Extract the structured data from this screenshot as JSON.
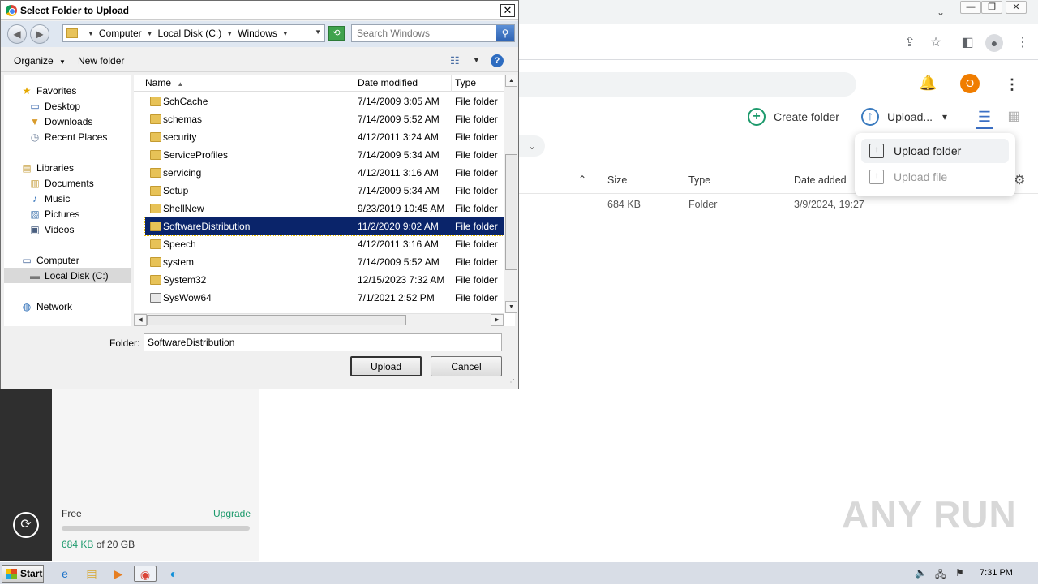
{
  "browser": {
    "window_controls": [
      "—",
      "❐",
      "✕"
    ],
    "tab_dropdown_icon": "chevron-down-icon",
    "toolbar_icons": [
      "share-icon",
      "star-icon",
      "sidepanel-icon",
      "profile-icon",
      "menu-icon"
    ]
  },
  "app": {
    "user_initial": "O",
    "create_folder_label": "Create folder",
    "upload_label": "Upload...",
    "upload_menu": {
      "items": [
        {
          "label": "Upload folder",
          "state": "hover"
        },
        {
          "label": "Upload file",
          "state": "disabled"
        }
      ]
    },
    "table": {
      "columns": [
        "Size",
        "Type",
        "Date added"
      ],
      "row": {
        "size": "684 KB",
        "type": "Folder",
        "date_added": "3/9/2024, 19:27"
      }
    },
    "sidebar": {
      "plan": "Free",
      "upgrade": "Upgrade",
      "quota_used": "684 KB",
      "quota_of": " of 20 GB",
      "quota_fraction": 0.0
    },
    "accent_color": "#1d9a6c"
  },
  "dialog": {
    "title": "Select Folder to Upload",
    "breadcrumb": [
      "Computer",
      "Local Disk (C:)",
      "Windows"
    ],
    "search_placeholder": "Search Windows",
    "toolbar": {
      "organize": "Organize",
      "new_folder": "New folder"
    },
    "nav": [
      {
        "label": "Favorites",
        "icon": "star-icon",
        "indent": 0
      },
      {
        "label": "Desktop",
        "icon": "desktop-icon",
        "indent": 1
      },
      {
        "label": "Downloads",
        "icon": "downloads-icon",
        "indent": 1
      },
      {
        "label": "Recent Places",
        "icon": "recent-places-icon",
        "indent": 1
      },
      {
        "label": "Libraries",
        "icon": "libraries-icon",
        "indent": 0
      },
      {
        "label": "Documents",
        "icon": "documents-icon",
        "indent": 1
      },
      {
        "label": "Music",
        "icon": "music-icon",
        "indent": 1
      },
      {
        "label": "Pictures",
        "icon": "pictures-icon",
        "indent": 1
      },
      {
        "label": "Videos",
        "icon": "videos-icon",
        "indent": 1
      },
      {
        "label": "Computer",
        "icon": "computer-icon",
        "indent": 0
      },
      {
        "label": "Local Disk (C:)",
        "icon": "disk-icon",
        "indent": 1,
        "selected": true
      },
      {
        "label": "Network",
        "icon": "network-icon",
        "indent": 0
      }
    ],
    "columns": {
      "name": "Name",
      "date": "Date modified",
      "type": "Type"
    },
    "files": [
      {
        "name": "SchCache",
        "date": "7/14/2009 3:05 AM",
        "type": "File folder"
      },
      {
        "name": "schemas",
        "date": "7/14/2009 5:52 AM",
        "type": "File folder"
      },
      {
        "name": "security",
        "date": "4/12/2011 3:24 AM",
        "type": "File folder"
      },
      {
        "name": "ServiceProfiles",
        "date": "7/14/2009 5:34 AM",
        "type": "File folder"
      },
      {
        "name": "servicing",
        "date": "4/12/2011 3:16 AM",
        "type": "File folder"
      },
      {
        "name": "Setup",
        "date": "7/14/2009 5:34 AM",
        "type": "File folder"
      },
      {
        "name": "ShellNew",
        "date": "9/23/2019 10:45 AM",
        "type": "File folder"
      },
      {
        "name": "SoftwareDistribution",
        "date": "11/2/2020 9:02 AM",
        "type": "File folder",
        "selected": true
      },
      {
        "name": "Speech",
        "date": "4/12/2011 3:16 AM",
        "type": "File folder"
      },
      {
        "name": "system",
        "date": "7/14/2009 5:52 AM",
        "type": "File folder"
      },
      {
        "name": "System32",
        "date": "12/15/2023 7:32 AM",
        "type": "File folder"
      },
      {
        "name": "SysWow64",
        "date": "7/1/2021 2:52 PM",
        "type": "File folder",
        "link": true
      }
    ],
    "folder_label": "Folder:",
    "folder_value": "SoftwareDistribution",
    "upload_button": "Upload",
    "cancel_button": "Cancel"
  },
  "taskbar": {
    "start_label": "Start",
    "apps": [
      "ie-icon",
      "explorer-icon",
      "media-player-icon",
      "chrome-icon",
      "edge-icon"
    ],
    "tray": [
      "volume-icon",
      "network-tray-icon",
      "flag-icon"
    ],
    "time": "7:31 PM"
  },
  "watermark": "ANY RUN"
}
